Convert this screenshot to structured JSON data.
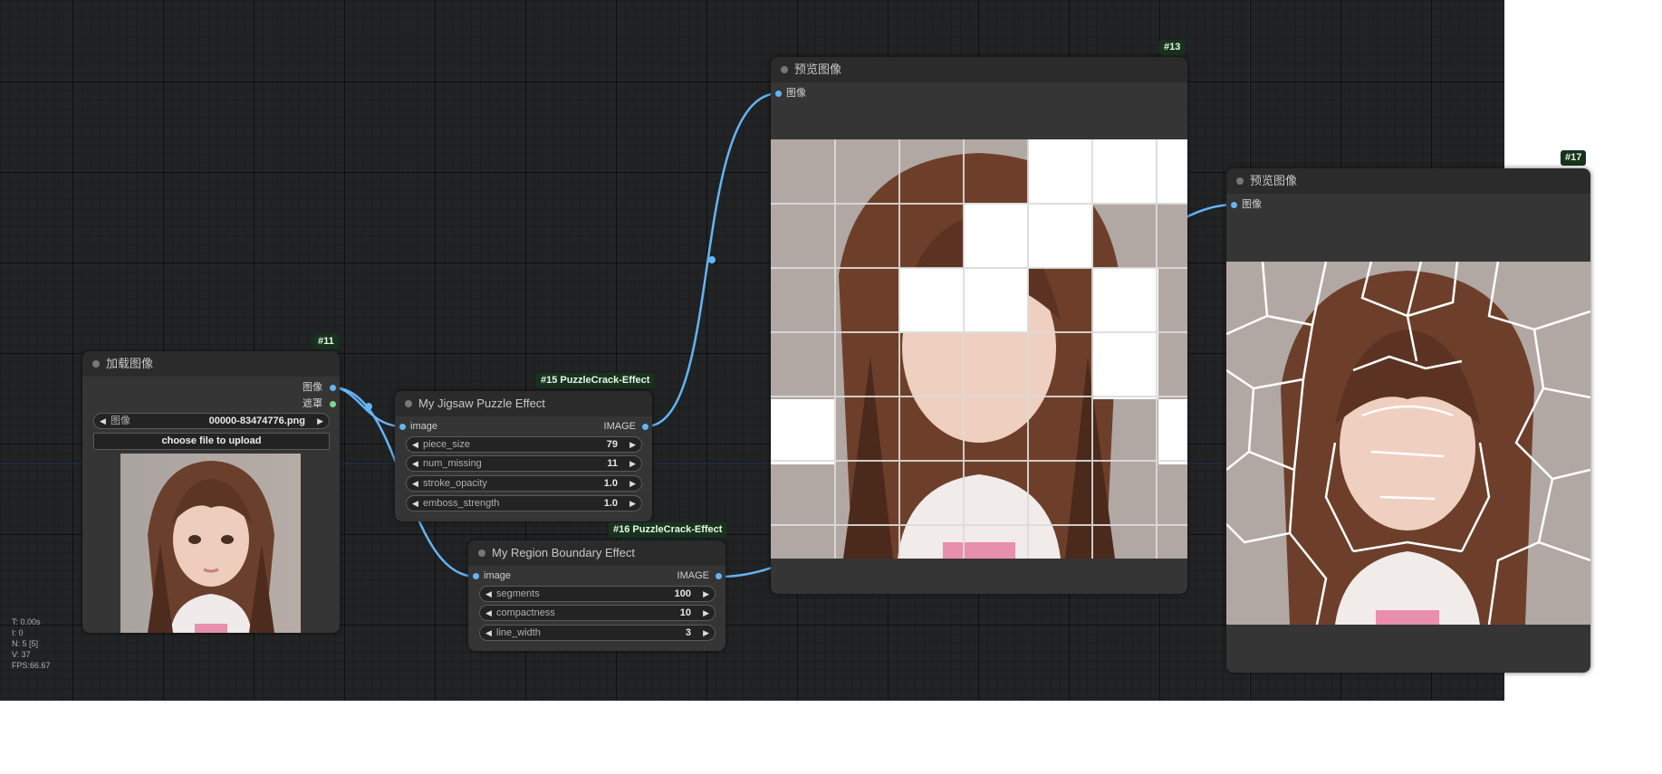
{
  "nodes": {
    "load_image": {
      "id": "#11",
      "title": "加载图像",
      "outputs": [
        "图像",
        "遮罩"
      ],
      "image_widget": {
        "label": "图像",
        "value": "00000-83474776.png"
      },
      "upload_button": "choose file to upload",
      "preview_icon": "portrait-image-icon"
    },
    "jigsaw": {
      "id": "#15 PuzzleCrack-Effect",
      "title": "My Jigsaw Puzzle Effect",
      "input": "image",
      "output": "IMAGE",
      "widgets": [
        {
          "label": "piece_size",
          "value": "79"
        },
        {
          "label": "num_missing",
          "value": "11"
        },
        {
          "label": "stroke_opacity",
          "value": "1.0"
        },
        {
          "label": "emboss_strength",
          "value": "1.0"
        }
      ]
    },
    "region": {
      "id": "#16 PuzzleCrack-Effect",
      "title": "My Region Boundary Effect",
      "input": "image",
      "output": "IMAGE",
      "widgets": [
        {
          "label": "segments",
          "value": "100"
        },
        {
          "label": "compactness",
          "value": "10"
        },
        {
          "label": "line_width",
          "value": "3"
        }
      ]
    },
    "preview1": {
      "id": "#13",
      "title": "预览图像",
      "input": "图像",
      "image_icon": "jigsaw-portrait-image-icon"
    },
    "preview2": {
      "id": "#17",
      "title": "预览图像",
      "input": "图像",
      "image_icon": "region-boundary-portrait-image-icon"
    }
  },
  "stats": {
    "t": "T: 0.00s",
    "i": "I: 0",
    "n": "N: 5 [5]",
    "v": "V: 37",
    "fps": "FPS:66.67"
  },
  "colors": {
    "canvas": "#222325",
    "node_bg": "#353535",
    "title_bg": "#2b2b2b",
    "wire": "#64b5f6",
    "badge_bg": "#17331d"
  }
}
